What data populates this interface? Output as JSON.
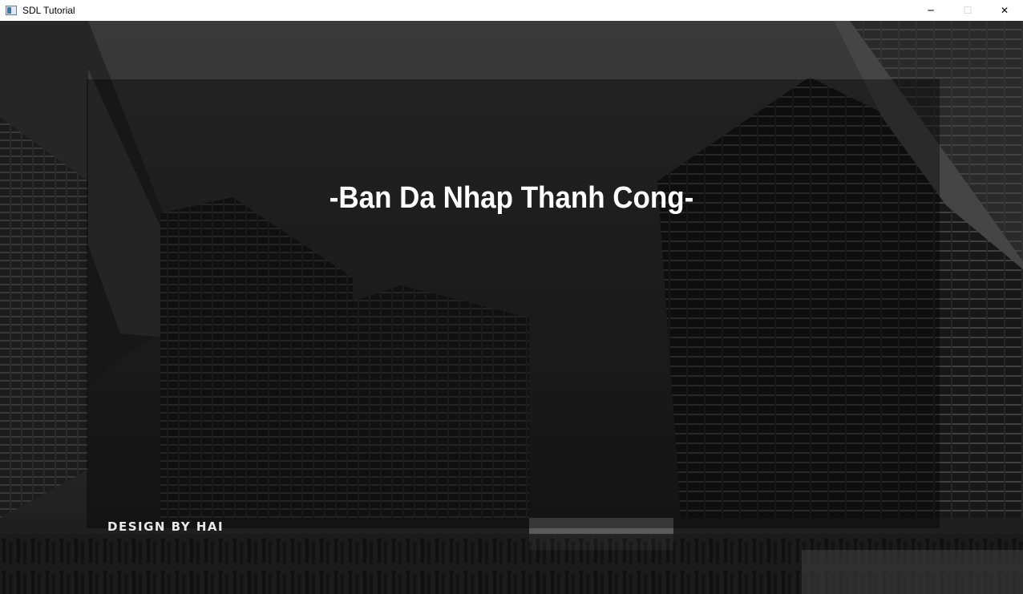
{
  "window": {
    "title": "SDL Tutorial",
    "icon": "app-window-icon",
    "controls": {
      "minimize": "─",
      "maximize": "☐",
      "close": "✕"
    }
  },
  "screen": {
    "headline": "-Ban Da Nhap Thanh Cong-",
    "credit": "DESIGN BY HAI",
    "background": "black-and-white photo of curved glass skyscrapers and a plaza with people"
  }
}
